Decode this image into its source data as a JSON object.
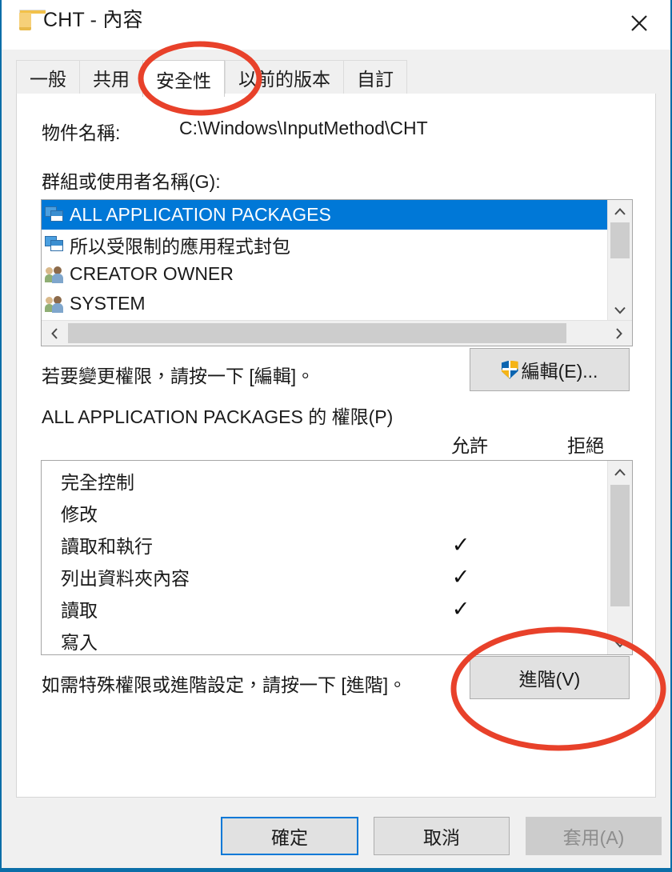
{
  "window": {
    "title": "CHT - 內容",
    "folder_icon": "folder-icon",
    "close_label": "✕"
  },
  "tabs": [
    {
      "label": "一般",
      "active": false
    },
    {
      "label": "共用",
      "active": false
    },
    {
      "label": "安全性",
      "active": true
    },
    {
      "label": "以前的版本",
      "active": false
    },
    {
      "label": "自訂",
      "active": false
    }
  ],
  "security": {
    "object_name_label": "物件名稱:",
    "object_name_value": "C:\\Windows\\InputMethod\\CHT",
    "groups_label": "群組或使用者名稱(G):",
    "users": [
      {
        "name": "ALL APPLICATION PACKAGES",
        "icon": "package-icon",
        "selected": true
      },
      {
        "name": "所以受限制的應用程式封包",
        "icon": "package-icon",
        "selected": false
      },
      {
        "name": "CREATOR OWNER",
        "icon": "group-icon",
        "selected": false
      },
      {
        "name": "SYSTEM",
        "icon": "group-icon",
        "selected": false
      }
    ],
    "edit_hint": "若要變更權限，請按一下 [編輯]。",
    "edit_button": "編輯(E)...",
    "permissions_title": "ALL APPLICATION PACKAGES 的 權限(P)",
    "col_allow": "允許",
    "col_deny": "拒絕",
    "permissions": [
      {
        "name": "完全控制",
        "allow": "",
        "deny": ""
      },
      {
        "name": "修改",
        "allow": "",
        "deny": ""
      },
      {
        "name": "讀取和執行",
        "allow": "✓",
        "deny": ""
      },
      {
        "name": "列出資料夾內容",
        "allow": "✓",
        "deny": ""
      },
      {
        "name": "讀取",
        "allow": "✓",
        "deny": ""
      },
      {
        "name": "寫入",
        "allow": "",
        "deny": ""
      }
    ],
    "advanced_hint": "如需特殊權限或進階設定，請按一下 [進階]。",
    "advanced_button": "進階(V)"
  },
  "footer": {
    "ok": "確定",
    "cancel": "取消",
    "apply": "套用(A)"
  },
  "annotations": {
    "accent_color": "#e8412a",
    "items": [
      {
        "name": "security-tab-highlight",
        "target": "安全性"
      },
      {
        "name": "advanced-button-highlight",
        "target": "進階(V)"
      }
    ]
  },
  "colors": {
    "selection_blue": "#0078d7",
    "window_border": "#0b6ea8",
    "panel_bg": "#f0f0f0",
    "annotation_red": "#e8412a"
  }
}
